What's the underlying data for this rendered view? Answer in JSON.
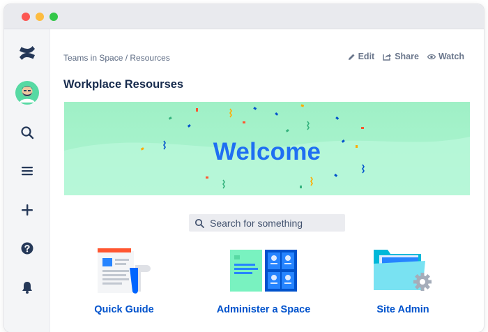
{
  "breadcrumb": "Teams in Space / Resources",
  "actions": {
    "edit": "Edit",
    "share": "Share",
    "watch": "Watch"
  },
  "page_title": "Workplace Resourses",
  "banner": {
    "text": "Welcome"
  },
  "search": {
    "placeholder": "Search for something"
  },
  "tiles": [
    {
      "label": "Quick Guide",
      "icon": "document-icon"
    },
    {
      "label": "Administer a Space",
      "icon": "space-board-icon"
    },
    {
      "label": "Site Admin",
      "icon": "folder-gear-icon"
    }
  ],
  "sidebar": [
    "confluence-logo",
    "avatar",
    "search-icon",
    "menu-icon",
    "plus-icon",
    "help-icon",
    "notification-icon"
  ],
  "colors": {
    "accent": "#0052CC",
    "banner": "#A6F2CC",
    "welcome": "#1F6FF2"
  }
}
